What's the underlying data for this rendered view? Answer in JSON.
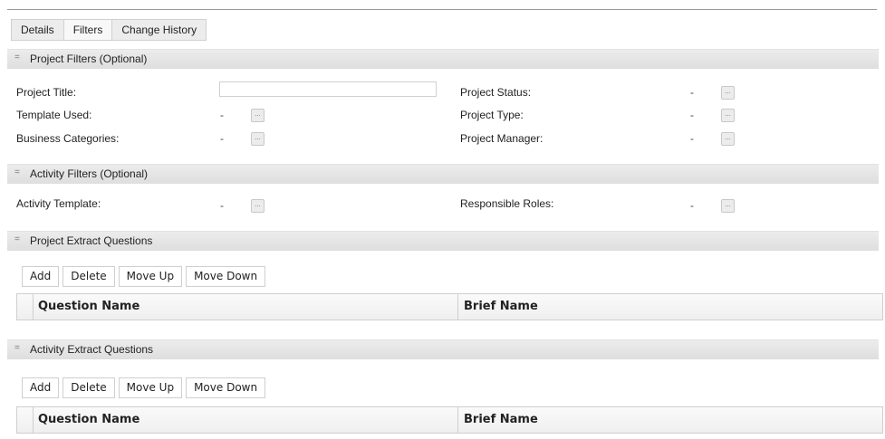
{
  "tabs": [
    {
      "label": "Details"
    },
    {
      "label": "Filters"
    },
    {
      "label": "Change History"
    }
  ],
  "project_filters": {
    "title": "Project Filters (Optional)",
    "project_title_label": "Project Title:",
    "project_title_value": "",
    "template_used_label": "Template Used:",
    "template_used_value": "-",
    "business_categories_label": "Business Categories:",
    "business_categories_value": "-",
    "project_status_label": "Project Status:",
    "project_status_value": "-",
    "project_type_label": "Project Type:",
    "project_type_value": "-",
    "project_manager_label": "Project Manager:",
    "project_manager_value": "-"
  },
  "activity_filters": {
    "title": "Activity Filters (Optional)",
    "activity_template_label": "Activity Template:",
    "activity_template_value": "-",
    "responsible_roles_label": "Responsible Roles:",
    "responsible_roles_value": "-"
  },
  "project_extract": {
    "title": "Project Extract Questions",
    "buttons": {
      "add": "Add",
      "delete": "Delete",
      "move_up": "Move Up",
      "move_down": "Move Down"
    },
    "columns": {
      "question_name": "Question Name",
      "brief_name": "Brief Name"
    }
  },
  "activity_extract": {
    "title": "Activity  Extract Questions",
    "buttons": {
      "add": "Add",
      "delete": "Delete",
      "move_up": "Move Up",
      "move_down": "Move Down"
    },
    "columns": {
      "question_name": "Question Name",
      "brief_name": "Brief Name"
    }
  },
  "icons": {
    "collapse": "collapse-icon",
    "picker": "ellipsis-picker-icon"
  },
  "picker_glyph": "...",
  "collapse_glyph": "="
}
